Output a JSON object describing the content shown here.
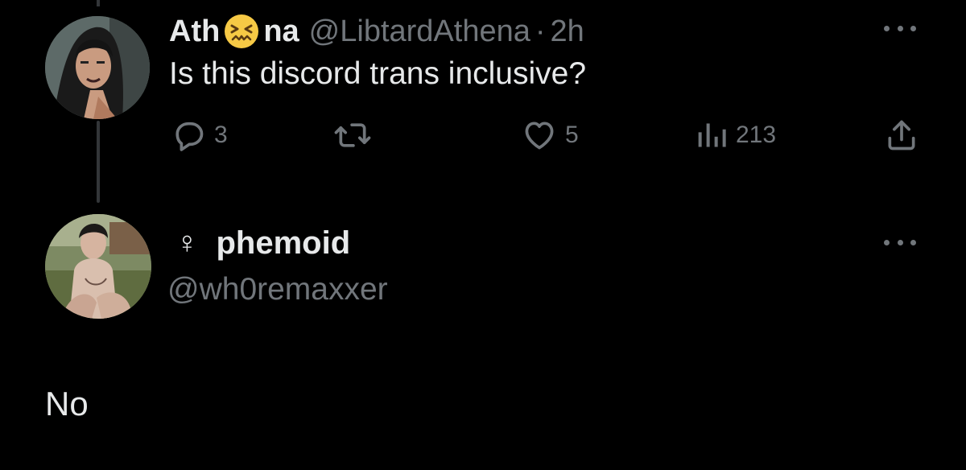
{
  "tweet": {
    "author_name_start": "Ath",
    "author_name_end": "na",
    "emoji": "confounded-face",
    "handle": "@LibtardAthena",
    "separator": "·",
    "time": "2h",
    "text": "Is this discord trans inclusive?",
    "stats": {
      "replies": "3",
      "likes": "5",
      "views": "213"
    }
  },
  "reply": {
    "name_symbol": "♀",
    "name": "phemoid",
    "handle": "@wh0remaxxer",
    "text": "No"
  },
  "colors": {
    "background": "#000000",
    "text": "#e7e9ea",
    "muted": "#71767b",
    "thread_line": "#333639"
  }
}
